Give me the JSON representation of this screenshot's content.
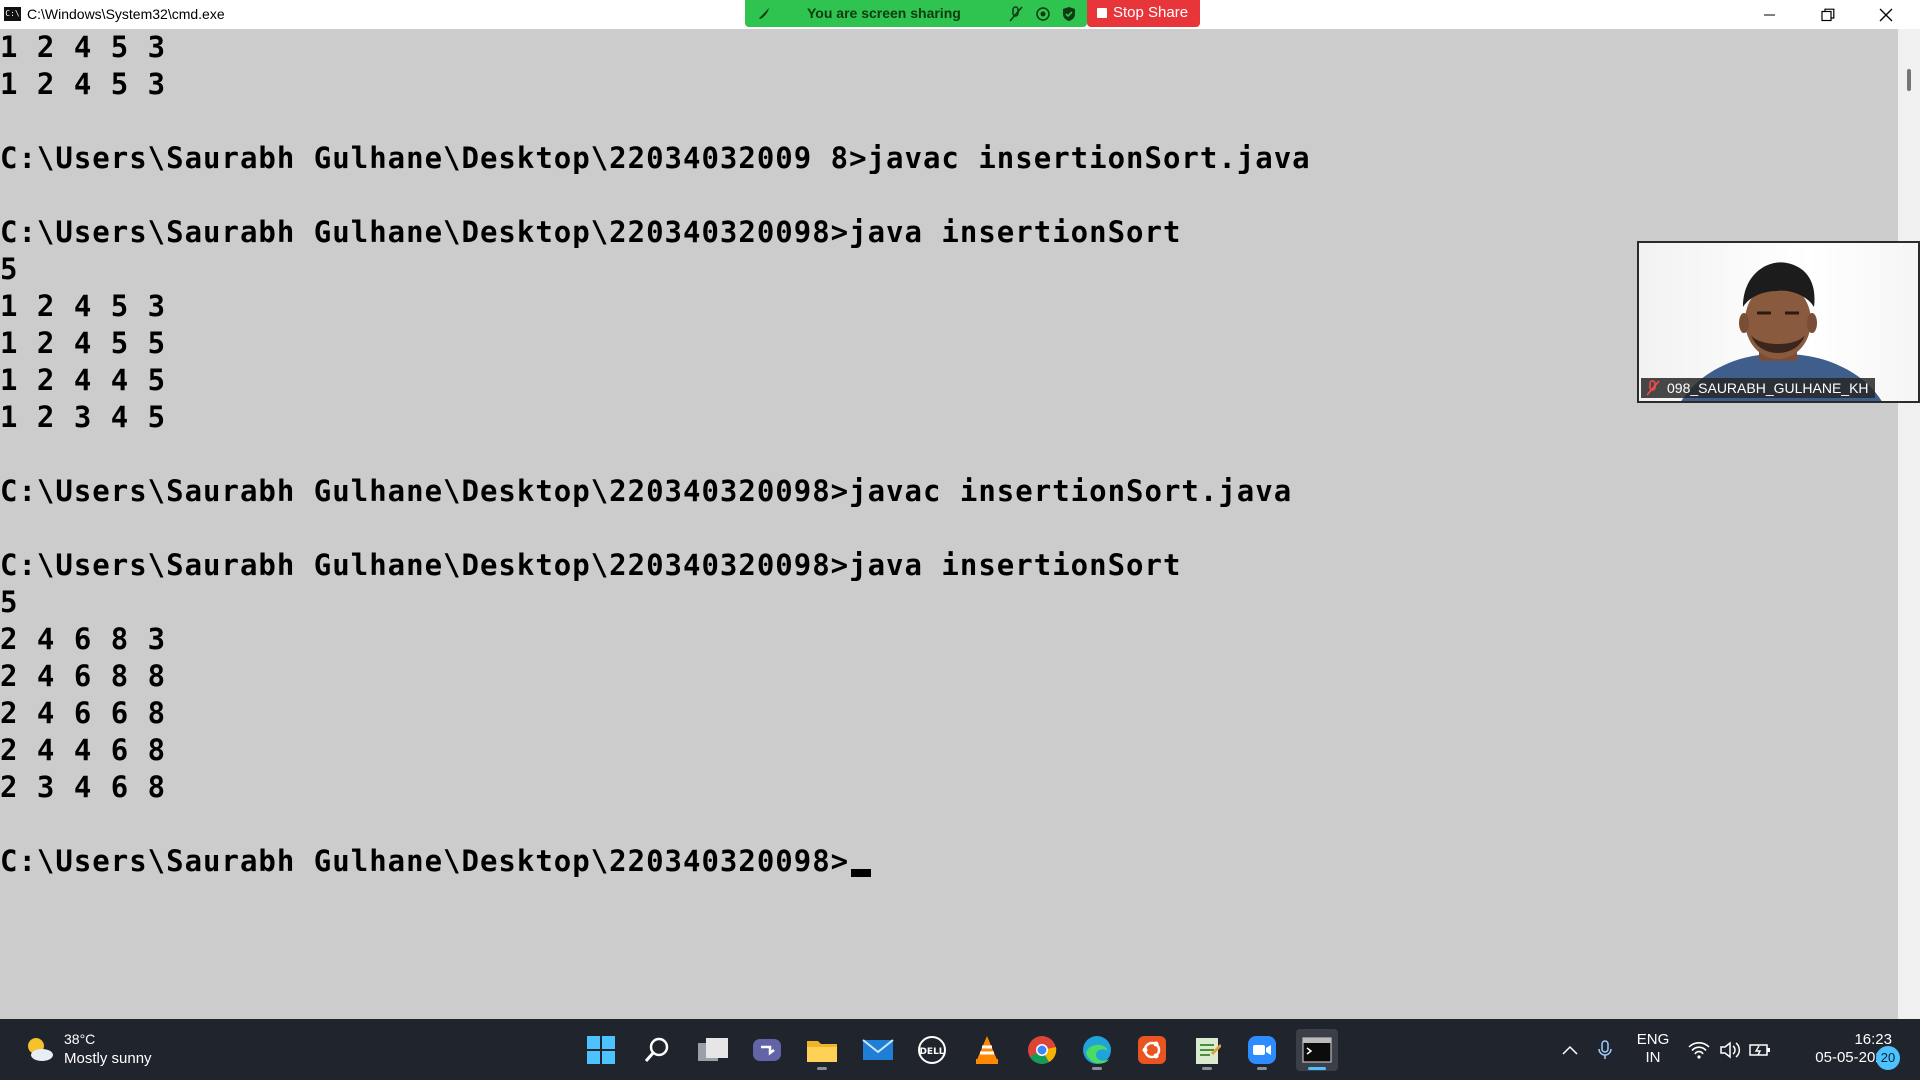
{
  "window": {
    "title": "C:\\Windows\\System32\\cmd.exe",
    "app_icon_text": "C:\\"
  },
  "share_bar": {
    "status": "You are screen sharing",
    "stop_label": "Stop Share",
    "color": "#2fc34f",
    "stop_color": "#e8353a"
  },
  "console": {
    "background": "#cccccc",
    "lines": [
      "1 2 4 5 3",
      "1 2 4 5 3",
      "",
      "C:\\Users\\Saurabh Gulhane\\Desktop\\22034032009 8>javac insertionSort.java",
      "",
      "C:\\Users\\Saurabh Gulhane\\Desktop\\220340320098>java insertionSort",
      "5",
      "1 2 4 5 3",
      "1 2 4 5 5",
      "1 2 4 4 5",
      "1 2 3 4 5",
      "",
      "C:\\Users\\Saurabh Gulhane\\Desktop\\220340320098>javac insertionSort.java",
      "",
      "C:\\Users\\Saurabh Gulhane\\Desktop\\220340320098>java insertionSort",
      "5",
      "2 4 6 8 3",
      "2 4 6 8 8",
      "2 4 6 6 8",
      "2 4 4 6 8",
      "2 3 4 6 8",
      "",
      "C:\\Users\\Saurabh Gulhane\\Desktop\\220340320098>"
    ]
  },
  "video": {
    "participant_name": "098_SAURABH_GULHANE_KH"
  },
  "taskbar": {
    "weather_temp": "38°C",
    "weather_condition": "Mostly sunny",
    "apps": [
      "start-icon",
      "search-icon",
      "task-view-icon",
      "teams-chat-icon",
      "file-explorer-icon",
      "mail-icon",
      "dell-icon",
      "vlc-icon",
      "chrome-icon",
      "edge-icon",
      "ubuntu-icon",
      "notepad-icon",
      "zoom-icon",
      "terminal-icon"
    ],
    "lang_top": "ENG",
    "lang_bottom": "IN",
    "time": "16:23",
    "date": "05-05-2022",
    "notifications": "20"
  }
}
